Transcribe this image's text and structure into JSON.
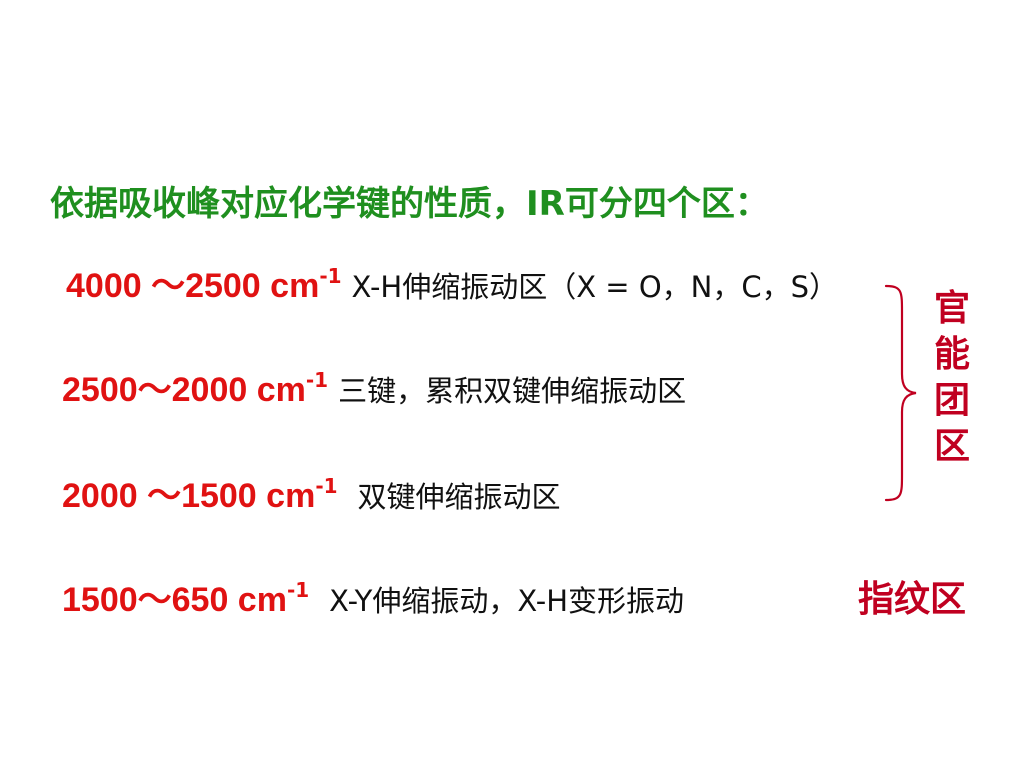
{
  "heading": "依据吸收峰对应化学键的性质，IR可分四个区：",
  "rows": [
    {
      "range": "4000 ～2500 cm",
      "sup": "-1",
      "desc": "X-H伸缩振动区（X = O，N，C，S）"
    },
    {
      "range": "2500～2000 cm",
      "sup": "-1",
      "desc": "三键，累积双键伸缩振动区"
    },
    {
      "range": "2000 ～1500 cm",
      "sup": "-1",
      "desc": "双键伸缩振动区"
    },
    {
      "range": "1500～650 cm",
      "sup": "-1",
      "desc": "X-Y伸缩振动，X-H变形振动"
    }
  ],
  "functional_group_label": [
    "官",
    "能",
    "团",
    "区"
  ],
  "fingerprint_label": "指纹区",
  "colors": {
    "heading": "#1f8f1f",
    "range": "#e01212",
    "label": "#c00020",
    "brace": "#c00020"
  }
}
